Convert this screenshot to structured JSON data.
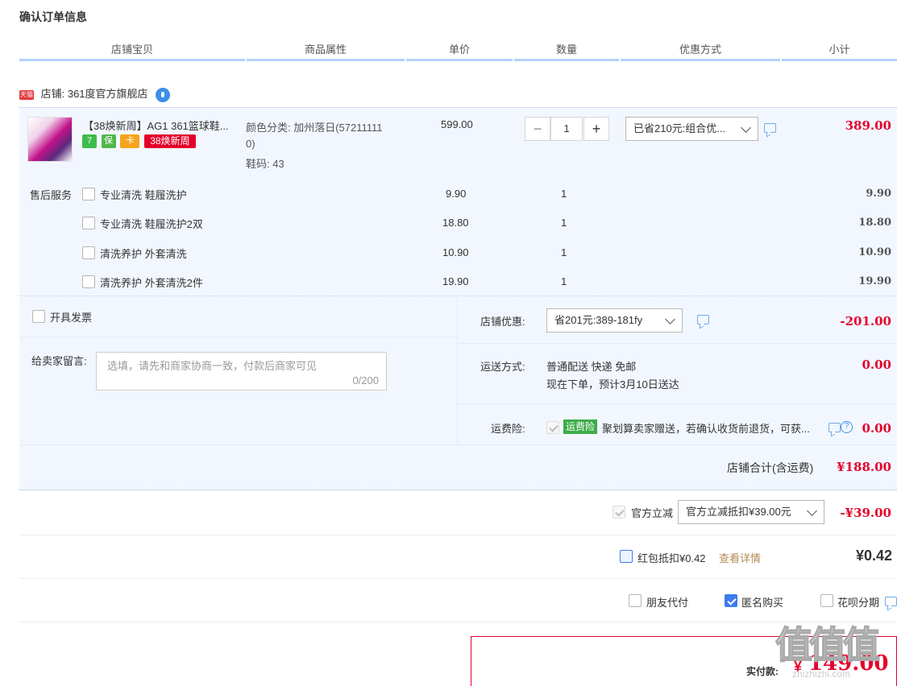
{
  "page_title": "确认订单信息",
  "columns": [
    "店铺宝贝",
    "商品属性",
    "单价",
    "数量",
    "优惠方式",
    "小计"
  ],
  "shop": {
    "badge": "天猫",
    "label": "店铺: 361度官方旗舰店"
  },
  "item": {
    "title": "【38焕新周】AG1 361篮球鞋...",
    "tags": [
      "7",
      "保",
      "卡",
      "38焕新周"
    ],
    "attr_color": "颜色分类: 加州落日(57211111",
    "attr_color_cont": "0)",
    "attr_size": "鞋码: 43",
    "unit_price": "599.00",
    "quantity": "1",
    "qty_minus": "−",
    "qty_plus": "+",
    "discount_option": "已省210元:组合优...",
    "subtotal": "389.00"
  },
  "after_sales": {
    "label": "售后服务",
    "rows": [
      {
        "name": "专业清洗 鞋履洗护",
        "price": "9.90",
        "qty": "1",
        "subtotal": "9.90"
      },
      {
        "name": "专业清洗 鞋履洗护2双",
        "price": "18.80",
        "qty": "1",
        "subtotal": "18.80"
      },
      {
        "name": "清洗养护 外套清洗",
        "price": "10.90",
        "qty": "1",
        "subtotal": "10.90"
      },
      {
        "name": "清洗养护 外套清洗2件",
        "price": "19.90",
        "qty": "1",
        "subtotal": "19.90"
      }
    ]
  },
  "invoice_label": "开具发票",
  "message": {
    "label": "给卖家留言:",
    "placeholder": "选填，请先和商家协商一致，付款后商家可见",
    "counter": "0/200"
  },
  "shop_discount": {
    "label": "店铺优惠:",
    "option": "省201元:389-181fy",
    "amount": "-201.00"
  },
  "shipping": {
    "label": "运送方式:",
    "line1": "普通配送 快递 免邮",
    "line2": "现在下单，预计3月10日送达",
    "amount": "0.00"
  },
  "insurance": {
    "label": "运费险:",
    "tag": "运费险",
    "text": "聚划算卖家赠送，若确认收货前退货，可获...",
    "amount": "0.00"
  },
  "shop_total": {
    "label": "店铺合计(含运费)",
    "amount": "¥188.00"
  },
  "official_discount": {
    "label": "官方立减",
    "option": "官方立减抵扣¥39.00元",
    "amount": "-¥39.00"
  },
  "red_packet": {
    "label": "红包抵扣¥0.42",
    "link": "查看详情",
    "amount": "¥0.42"
  },
  "options": {
    "friend_pay": "朋友代付",
    "anonymous": "匿名购买",
    "huabei": "花呗分期"
  },
  "final": {
    "label": "实付款:",
    "currency": "¥",
    "amount": "149.00"
  },
  "watermark": {
    "text": "值值值",
    "sub": "zhizhizhi.com"
  },
  "colors": {
    "accent_red": "#e4002b",
    "accent_blue": "#3e7bef",
    "panel_bg": "#f2f7ff"
  }
}
